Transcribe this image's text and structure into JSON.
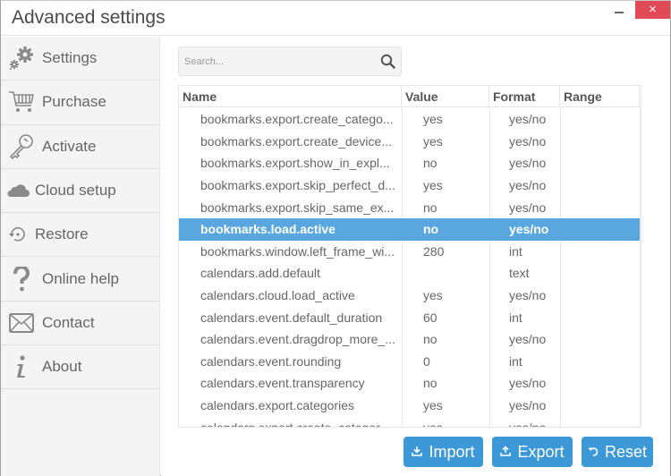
{
  "window": {
    "title": "Advanced settings",
    "minimize_icon": "minimize-icon",
    "close_icon": "close-icon",
    "close_glyph": "×"
  },
  "sidebar": {
    "items": [
      {
        "label": "Settings",
        "icon": "gears-icon"
      },
      {
        "label": "Purchase",
        "icon": "cart-icon"
      },
      {
        "label": "Activate",
        "icon": "key-icon"
      },
      {
        "label": "Cloud setup",
        "icon": "cloud-icon"
      },
      {
        "label": "Restore",
        "icon": "restore-icon"
      },
      {
        "label": "Online help",
        "icon": "question-icon"
      },
      {
        "label": "Contact",
        "icon": "envelope-icon"
      },
      {
        "label": "About",
        "icon": "info-icon"
      }
    ]
  },
  "search": {
    "placeholder": "Search...",
    "value": "",
    "icon": "search-icon"
  },
  "table": {
    "columns": [
      "Name",
      "Value",
      "Format",
      "Range"
    ],
    "selected_index": 5,
    "rows": [
      {
        "name": "bookmarks.export.create_catego...",
        "value": "yes",
        "format": "yes/no",
        "range": ""
      },
      {
        "name": "bookmarks.export.create_device...",
        "value": "yes",
        "format": "yes/no",
        "range": ""
      },
      {
        "name": "bookmarks.export.show_in_expl...",
        "value": "no",
        "format": "yes/no",
        "range": ""
      },
      {
        "name": "bookmarks.export.skip_perfect_d...",
        "value": "yes",
        "format": "yes/no",
        "range": ""
      },
      {
        "name": "bookmarks.export.skip_same_ex...",
        "value": "no",
        "format": "yes/no",
        "range": ""
      },
      {
        "name": "bookmarks.load.active",
        "value": "no",
        "format": "yes/no",
        "range": ""
      },
      {
        "name": "bookmarks.window.left_frame_wi...",
        "value": "280",
        "format": "int",
        "range": ""
      },
      {
        "name": "calendars.add.default",
        "value": "",
        "format": "text",
        "range": ""
      },
      {
        "name": "calendars.cloud.load_active",
        "value": "yes",
        "format": "yes/no",
        "range": ""
      },
      {
        "name": "calendars.event.default_duration",
        "value": "60",
        "format": "int",
        "range": ""
      },
      {
        "name": "calendars.event.dragdrop_more_...",
        "value": "no",
        "format": "yes/no",
        "range": ""
      },
      {
        "name": "calendars.event.rounding",
        "value": "0",
        "format": "int",
        "range": ""
      },
      {
        "name": "calendars.event.transparency",
        "value": "no",
        "format": "yes/no",
        "range": ""
      },
      {
        "name": "calendars.export.categories",
        "value": "yes",
        "format": "yes/no",
        "range": ""
      },
      {
        "name": "calendars.export.create_categor...",
        "value": "yes",
        "format": "yes/no",
        "range": ""
      }
    ],
    "scroll_up_glyph": "˄",
    "scroll_down_glyph": "˅"
  },
  "actions": {
    "import": {
      "label": "Import",
      "icon": "import-icon",
      "glyph": "⭳"
    },
    "export": {
      "label": "Export",
      "icon": "export-icon",
      "glyph": "⭱"
    },
    "reset": {
      "label": "Reset",
      "icon": "undo-icon",
      "glyph": "↶"
    }
  },
  "colors": {
    "accent": "#3d98d8",
    "selection": "#5aa7e0",
    "close": "#e04a56"
  }
}
